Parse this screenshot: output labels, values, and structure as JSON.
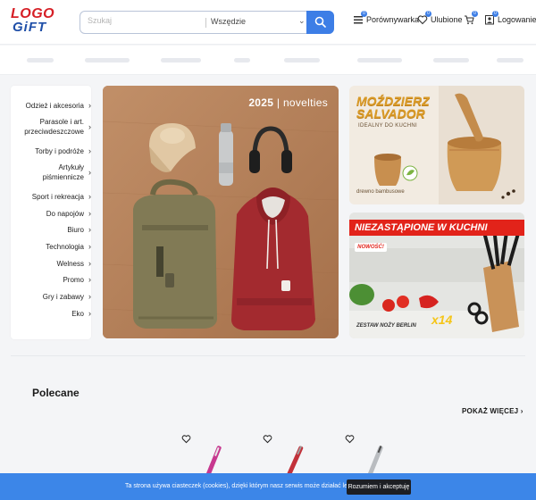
{
  "logo": {
    "line1": "LOGO",
    "line2": "GiFT"
  },
  "search": {
    "placeholder": "Szukaj",
    "scope": "Wszędzie"
  },
  "header_links": {
    "compare": {
      "label": "Porównywarka",
      "count": "0"
    },
    "favorites": {
      "label": "Ulubione",
      "count": "0"
    },
    "cart": {
      "count": "0"
    },
    "login": {
      "label": "Logowanie",
      "count": "0"
    }
  },
  "sidebar": {
    "categories": [
      {
        "label": "Odzież i akcesoria"
      },
      {
        "label": "Parasole i art. przeciwdeszczowe"
      },
      {
        "label": "Torby i podróże"
      },
      {
        "label": "Artykuły piśmiennicze"
      },
      {
        "label": "Sport i rekreacja"
      },
      {
        "label": "Do napojów"
      },
      {
        "label": "Biuro"
      },
      {
        "label": "Technologia"
      },
      {
        "label": "Welness"
      },
      {
        "label": "Promo"
      },
      {
        "label": "Gry i zabawy"
      },
      {
        "label": "Eko"
      }
    ]
  },
  "hero": {
    "year": "2025",
    "separator": "|",
    "tag": "novelties"
  },
  "promo_top": {
    "title_1": "MOŹDZIERZ",
    "title_2": "SALVADOR",
    "subtitle": "IDEALNY DO KUCHNI",
    "material": "drewno bambusowe"
  },
  "promo_bottom": {
    "title": "NIEZASTĄPIONE W KUCHNI",
    "badge": "NOWOŚĆ!",
    "set_name": "ZESTAW NOŻY BERLIN",
    "count": "x14"
  },
  "recommended": {
    "title": "Polecane",
    "more": "POKAŻ WIĘCEJ"
  },
  "cookie": {
    "text": "Ta strona używa ciasteczek (cookies), dzięki którym nasz serwis może działać lepiej.",
    "accept": "Rozumiem i akceptuję"
  },
  "colors": {
    "accent": "#3d7ee6",
    "logo_red": "#d61f26",
    "logo_blue": "#1f4fa8",
    "cookie_bg": "#3c86e8"
  },
  "icons": [
    "search-icon",
    "compare-icon",
    "heart-icon",
    "cart-icon",
    "user-icon",
    "chevron-right-icon",
    "chevron-down-icon"
  ]
}
